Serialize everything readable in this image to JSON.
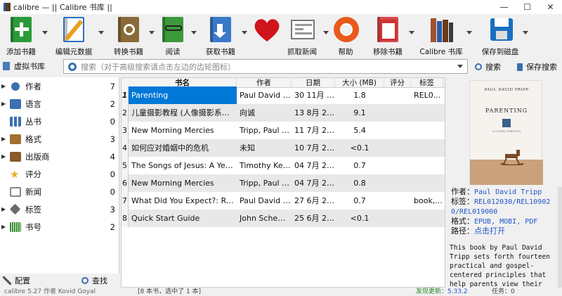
{
  "window": {
    "title": "calibre — || Calibre 书库 ||"
  },
  "toolbar": {
    "add_books": "添加书籍",
    "edit_metadata": "编辑元数据",
    "convert_books": "转换书籍",
    "view": "阅读",
    "get_books": "获取书籍",
    "fetch_news": "抓取新闻",
    "help": "帮助",
    "remove_books": "移除书籍",
    "library": "Calibre 书库",
    "save_to_disk": "保存到磁盘"
  },
  "search": {
    "virtual_library": "虚拟书库",
    "placeholder": "搜索（对于高级搜索请点击左边的齿轮图标）",
    "search_button": "搜索",
    "saved_searches": "保存搜索"
  },
  "tag_browser": {
    "items": [
      {
        "label": "作者",
        "count": "7",
        "color": "#3a6fb0"
      },
      {
        "label": "语言",
        "count": "2",
        "color": "#3a6fb0"
      },
      {
        "label": "丛书",
        "count": "0",
        "color": "#3a6fb0"
      },
      {
        "label": "格式",
        "count": "3",
        "color": "#a07030"
      },
      {
        "label": "出版商",
        "count": "4",
        "color": "#8a5a2a"
      },
      {
        "label": "评分",
        "count": "0",
        "color": "#e8b020"
      },
      {
        "label": "新闻",
        "count": "0",
        "color": "#888888"
      },
      {
        "label": "标签",
        "count": "3",
        "color": "#6a6a6a"
      },
      {
        "label": "书号",
        "count": "2",
        "color": "#2a8a2a"
      }
    ],
    "configure": "配置",
    "find": "查找"
  },
  "table": {
    "columns": [
      "书名",
      "作者",
      "日期",
      "大小 (MB)",
      "评分",
      "标签"
    ],
    "rows": [
      {
        "num": "1",
        "title": "Parenting",
        "author": "Paul David Tri...",
        "date": "30 11月 2...",
        "size": "1.8",
        "rating": "",
        "tags": "REL0..."
      },
      {
        "num": "2",
        "title": "儿童摄影教程 (人像摄影系列教...",
        "author": "向诚",
        "date": "13 8月 2021",
        "size": "9.1",
        "rating": "",
        "tags": ""
      },
      {
        "num": "3",
        "title": "New Morning Mercies",
        "author": "Tripp, Paul D...",
        "date": "11 7月 2021",
        "size": "5.4",
        "rating": "",
        "tags": ""
      },
      {
        "num": "4",
        "title": "如何应对婚姻中的危机",
        "author": "未知",
        "date": "10 7月 2021",
        "size": "<0.1",
        "rating": "",
        "tags": ""
      },
      {
        "num": "5",
        "title": "The Songs of Jesus: A Year o...",
        "author": "Timothy Kelle...",
        "date": "04 7月 2021",
        "size": "0.7",
        "rating": "",
        "tags": ""
      },
      {
        "num": "6",
        "title": "New Morning Mercies",
        "author": "Tripp, Paul D...",
        "date": "04 7月 2021",
        "size": "0.8",
        "rating": "",
        "tags": ""
      },
      {
        "num": "7",
        "title": "What Did You Expect?: Rede...",
        "author": "Paul David Tri...",
        "date": "27 6月 2021",
        "size": "0.7",
        "rating": "",
        "tags": "book,..."
      },
      {
        "num": "8",
        "title": "Quick Start Guide",
        "author": "John Schember",
        "date": "25 6月 2021",
        "size": "<0.1",
        "rating": "",
        "tags": ""
      }
    ]
  },
  "details": {
    "cover_author": "PAUL DAVID TRIPP",
    "cover_title": "PARENTING",
    "cover_subtitle": "14 GOSPEL PRINCIPLES",
    "authors_label": "作者：",
    "authors_value": "Paul David Tripp",
    "tags_label": "标签：",
    "tags_value": "REL012030/REL109020/REL019000",
    "formats_label": "格式：",
    "formats_value": "EPUB, MOBI, PDF",
    "path_label": "路径：",
    "path_value": "点击打开",
    "description": "This book by Paul David Tripp sets forth fourteen practical and gospel-centered principles that help parents view their"
  },
  "status": {
    "left": "calibre 5.27 作者 Kovid Goyal",
    "mid": "[8 本书，选中了 1 本]",
    "update": "发现更新：",
    "update_version": "5.33.2",
    "jobs": "任务：0"
  }
}
